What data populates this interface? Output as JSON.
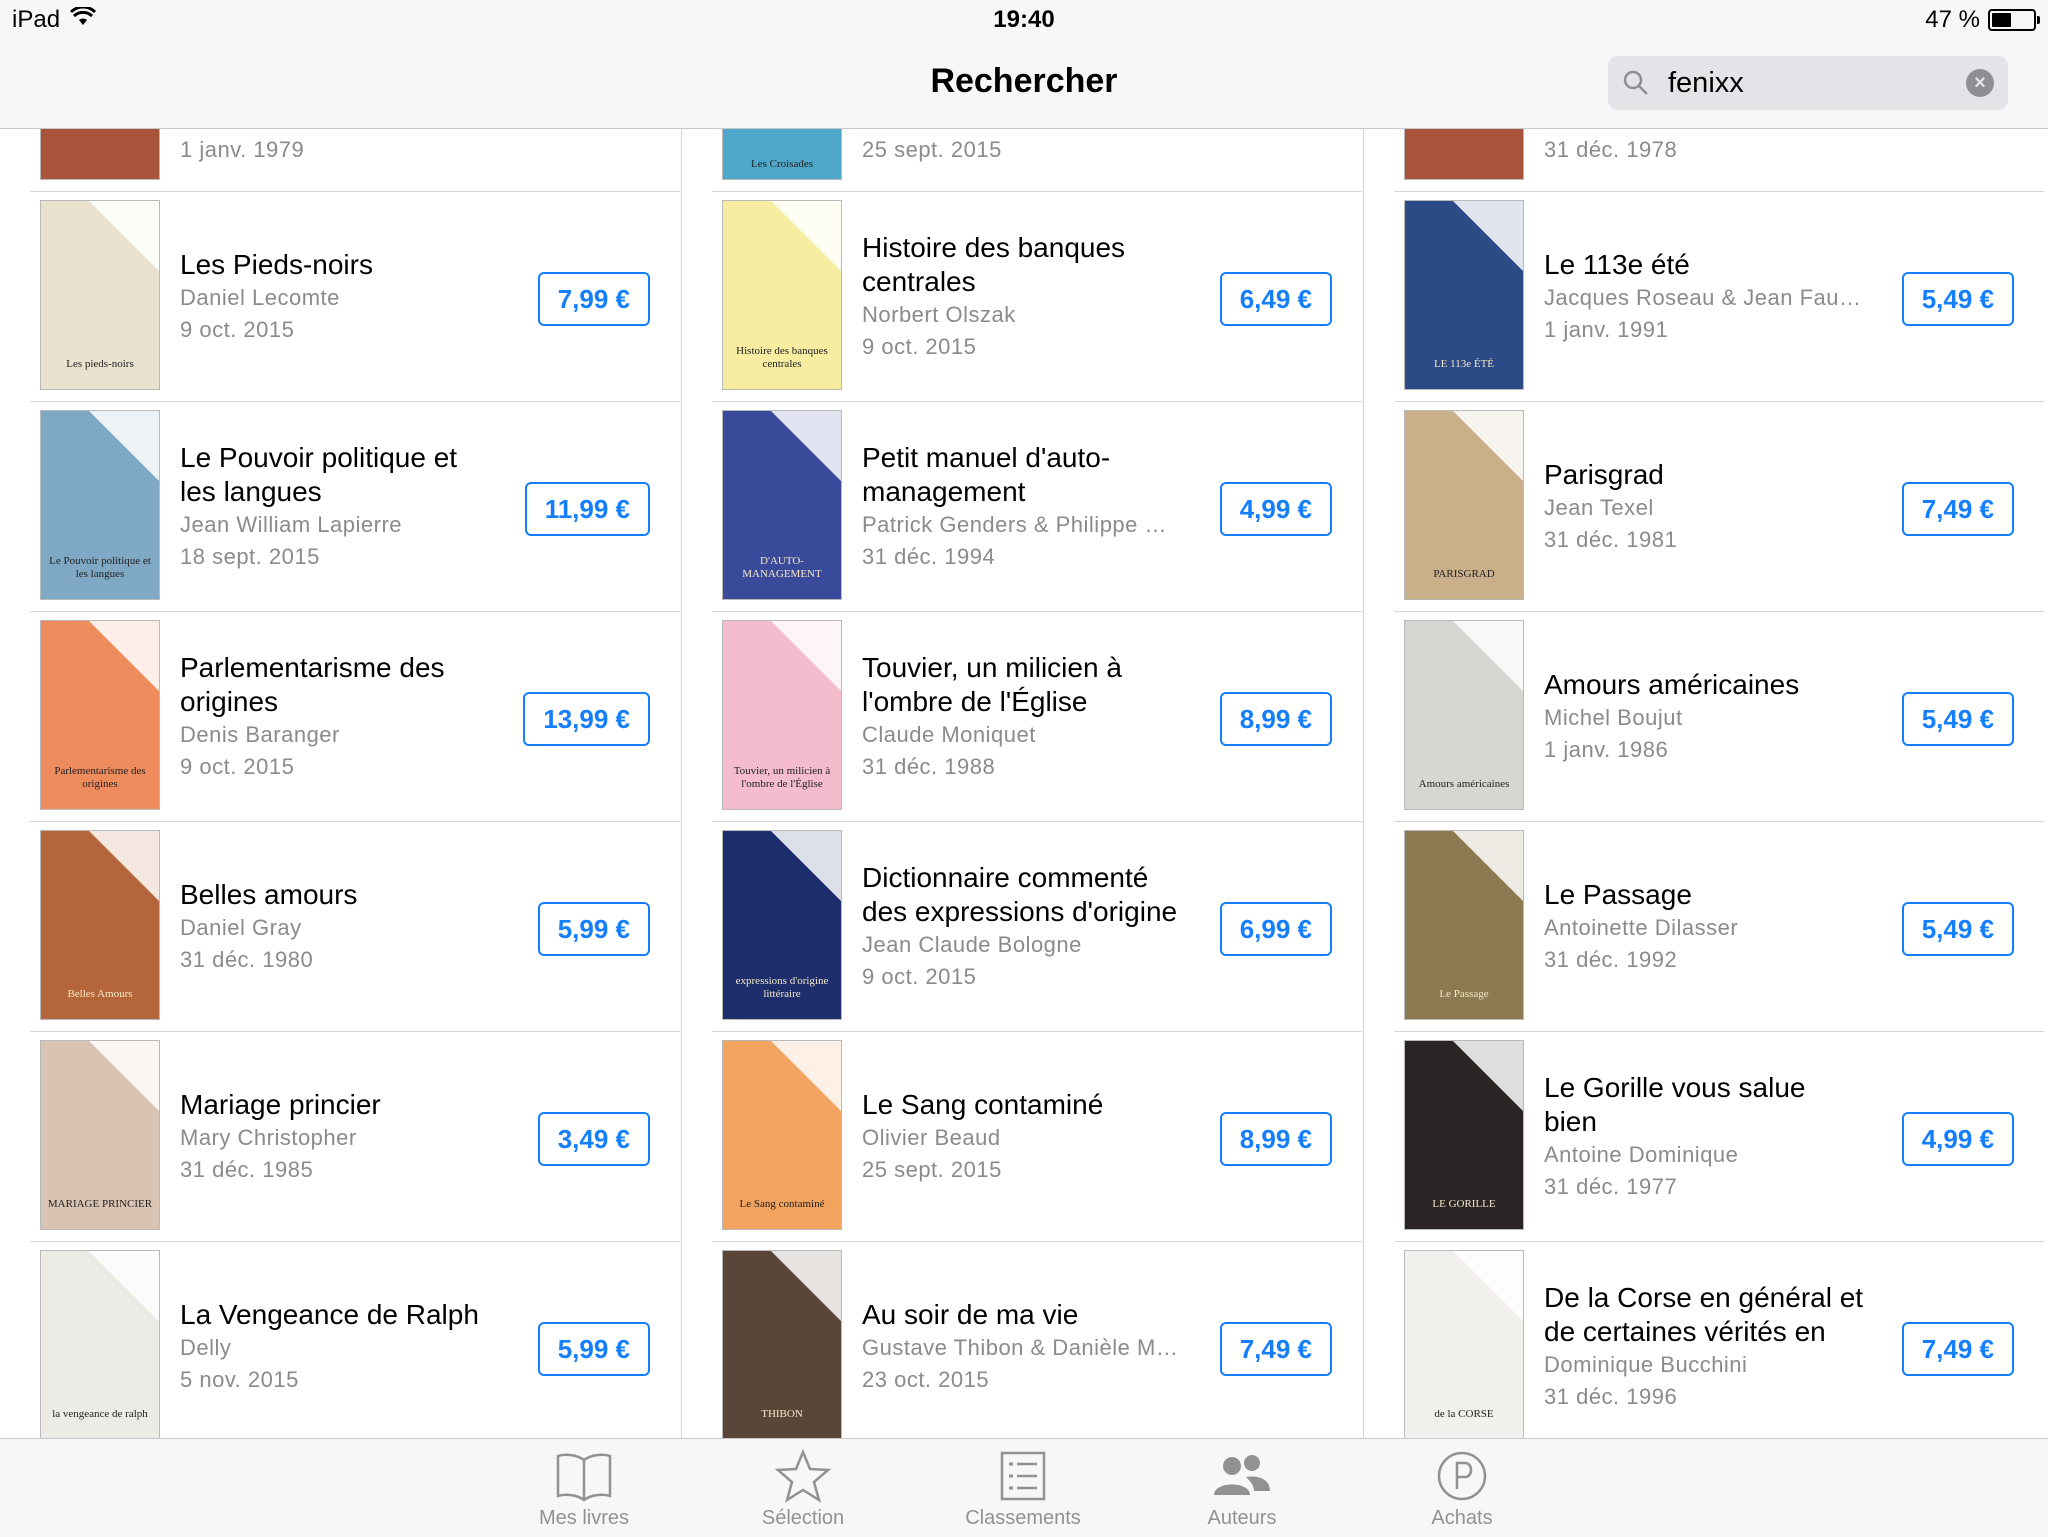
{
  "status": {
    "device": "iPad",
    "time": "19:40",
    "battery": "47 %",
    "battery_level": 0.47
  },
  "nav": {
    "title": "Rechercher"
  },
  "search": {
    "value": "fenixx"
  },
  "partial_row": [
    {
      "date": "1 janv. 1979"
    },
    {
      "date": "25 sept. 2015",
      "cover_text": "Les Croisades"
    },
    {
      "date": "31 déc. 1978"
    }
  ],
  "columns": [
    [
      {
        "title": "Les Pieds-noirs",
        "author": "Daniel Lecomte",
        "date": "9 oct. 2015",
        "price": "7,99 €",
        "cover_color": "#e9e2cf",
        "cover_text": "Les pieds-noirs"
      },
      {
        "title": "Le Pouvoir politique et les langues",
        "author": "Jean William Lapierre",
        "date": "18 sept. 2015",
        "price": "11,99 €",
        "cover_color": "#7ea8c4",
        "cover_text": "Le Pouvoir politique et les langues"
      },
      {
        "title": "Parlementarisme des origines",
        "author": "Denis Baranger",
        "date": "9 oct. 2015",
        "price": "13,99 €",
        "cover_color": "#ee8c5e",
        "cover_text": "Parlementarisme des origines"
      },
      {
        "title": "Belles amours",
        "author": "Daniel Gray",
        "date": "31 déc. 1980",
        "price": "5,99 €",
        "cover_color": "#b5653a",
        "cover_text": "Belles Amours"
      },
      {
        "title": "Mariage princier",
        "author": "Mary Christopher",
        "date": "31 déc. 1985",
        "price": "3,49 €",
        "cover_color": "#d9c3b3",
        "cover_text": "MARIAGE PRINCIER"
      },
      {
        "title": "La Vengeance de Ralph",
        "author": "Delly",
        "date": "5 nov. 2015",
        "price": "5,99 €",
        "cover_color": "#ecebe6",
        "cover_text": "la vengeance de ralph"
      }
    ],
    [
      {
        "title": "Histoire des banques centrales",
        "author": "Norbert Olszak",
        "date": "9 oct. 2015",
        "price": "6,49 €",
        "cover_color": "#f6eda1",
        "cover_text": "Histoire des banques centrales"
      },
      {
        "title": "Petit manuel d'auto-management",
        "author": "Patrick Genders & Philippe Gutchier",
        "date": "31 déc. 1994",
        "price": "4,99 €",
        "cover_color": "#3a4a9a",
        "cover_text": "D'AUTO-MANAGEMENT"
      },
      {
        "title": "Touvier, un milicien à l'ombre de l'Église",
        "author": "Claude Moniquet",
        "date": "31 déc. 1988",
        "price": "8,99 €",
        "cover_color": "#f4bccd",
        "cover_text": "Touvier, un milicien à l'ombre de l'Église"
      },
      {
        "title": "Dictionnaire commenté des expressions d'origine littéraire",
        "author": "Jean Claude Bologne",
        "date": "9 oct. 2015",
        "price": "6,99 €",
        "cover_color": "#1e2d6b",
        "cover_text": "expressions d'origine littéraire"
      },
      {
        "title": "Le Sang contaminé",
        "author": "Olivier Beaud",
        "date": "25 sept. 2015",
        "price": "8,99 €",
        "cover_color": "#f2a35e",
        "cover_text": "Le Sang contaminé"
      },
      {
        "title": "Au soir de ma vie",
        "author": "Gustave Thibon & Danièle Masson",
        "date": "23 oct. 2015",
        "price": "7,49 €",
        "cover_color": "#5a4638",
        "cover_text": "THIBON"
      }
    ],
    [
      {
        "title": "Le 113e été",
        "author": "Jacques Roseau & Jean Fauque",
        "date": "1 janv. 1991",
        "price": "5,49 €",
        "cover_color": "#2c4a86",
        "cover_text": "LE 113e ÉTÉ"
      },
      {
        "title": "Parisgrad",
        "author": "Jean Texel",
        "date": "31 déc. 1981",
        "price": "7,49 €",
        "cover_color": "#c9b08a",
        "cover_text": "PARISGRAD"
      },
      {
        "title": "Amours américaines",
        "author": "Michel Boujut",
        "date": "1 janv. 1986",
        "price": "5,49 €",
        "cover_color": "#d8d6d2",
        "cover_text": "Amours américaines"
      },
      {
        "title": "Le Passage",
        "author": "Antoinette Dilasser",
        "date": "31 déc. 1992",
        "price": "5,49 €",
        "cover_color": "#8c7a52",
        "cover_text": "Le Passage"
      },
      {
        "title": "Le Gorille vous salue bien",
        "author": "Antoine Dominique",
        "date": "31 déc. 1977",
        "price": "4,99 €",
        "cover_color": "#2a2424",
        "cover_text": "LE GORILLE"
      },
      {
        "title": "De la Corse en général et de certaines vérités en particulier",
        "author": "Dominique Bucchini",
        "date": "31 déc. 1996",
        "price": "7,49 €",
        "cover_color": "#f2f0ec",
        "cover_text": "de la CORSE"
      }
    ]
  ],
  "tabbar": {
    "tabs": [
      {
        "label": "Mes livres",
        "icon": "book-icon"
      },
      {
        "label": "Sélection",
        "icon": "star-icon"
      },
      {
        "label": "Classements",
        "icon": "list-icon"
      },
      {
        "label": "Auteurs",
        "icon": "people-icon"
      },
      {
        "label": "Achats",
        "icon": "purchased-icon"
      }
    ]
  }
}
